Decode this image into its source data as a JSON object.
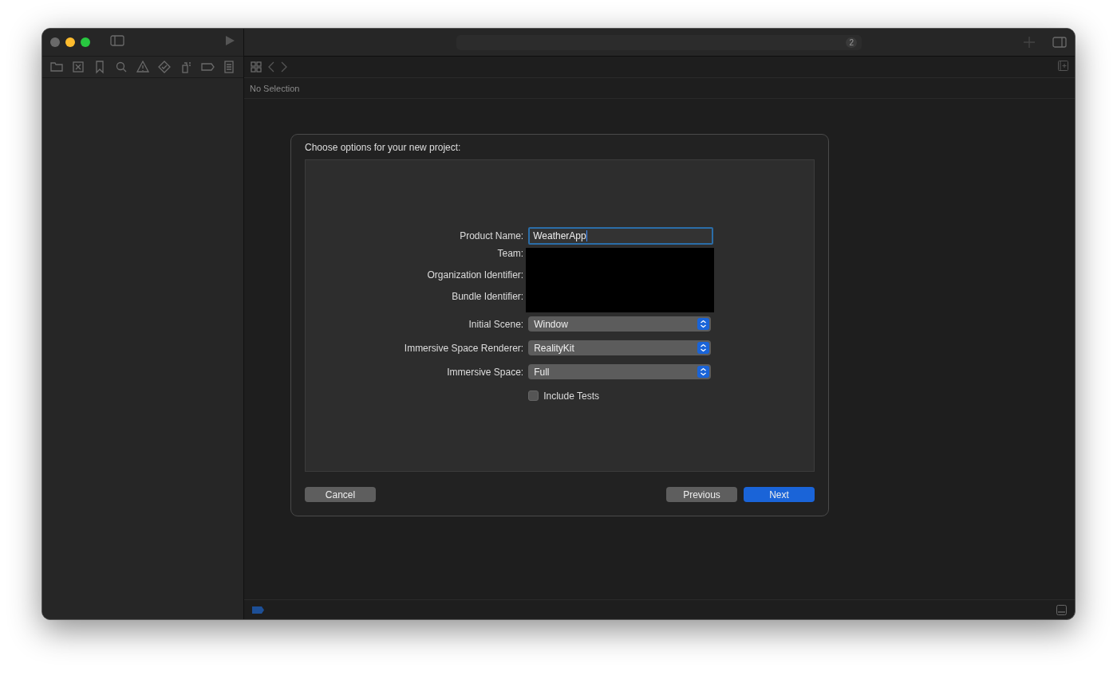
{
  "toolbar": {
    "badge": "2"
  },
  "editor": {
    "jump_bar": "No Selection"
  },
  "dialog": {
    "title": "Choose options for your new project:",
    "rows": [
      {
        "kind": "text",
        "label": "Product Name:",
        "value": "WeatherApp",
        "focused": true
      },
      {
        "kind": "redacted",
        "label": "Team:"
      },
      {
        "kind": "redacted",
        "label": "Organization Identifier:"
      },
      {
        "kind": "redacted",
        "label": "Bundle Identifier:"
      },
      {
        "kind": "popup",
        "label": "Initial Scene:",
        "value": "Window"
      },
      {
        "kind": "popup",
        "label": "Immersive Space Renderer:",
        "value": "RealityKit"
      },
      {
        "kind": "popup",
        "label": "Immersive Space:",
        "value": "Full"
      },
      {
        "kind": "checkbox",
        "label": "Include Tests",
        "checked": false
      }
    ],
    "buttons": [
      {
        "label": "Cancel",
        "kind": "plain"
      },
      {
        "label": "Previous",
        "kind": "plain"
      },
      {
        "label": "Next",
        "kind": "default"
      }
    ]
  }
}
